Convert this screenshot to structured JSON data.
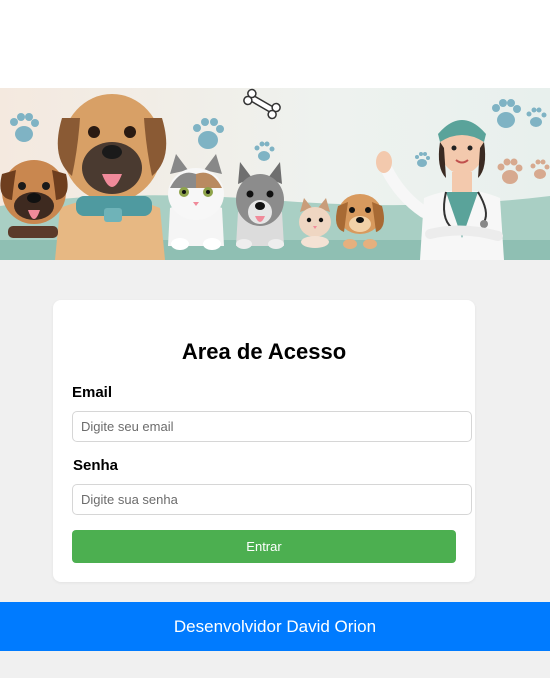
{
  "banner": {
    "image_alt": "",
    "icons": [
      "dog-icon",
      "cat-icon",
      "paw-icon",
      "bone-icon",
      "veterinarian-icon"
    ],
    "colors": {
      "teal": "#8fbfb3",
      "cream": "#f3ece4",
      "paw": "#7fb3c4"
    }
  },
  "login": {
    "title": "Area de Acesso",
    "email_label": "Email",
    "email_placeholder": "Digite seu email",
    "email_value": "",
    "password_label": "Senha",
    "password_placeholder": "Digite sua senha",
    "password_value": "",
    "submit_label": "Entrar"
  },
  "footer": {
    "text": "Desenvolvidor David Orion"
  },
  "colors": {
    "submit": "#4caf50",
    "footer": "#007bff",
    "background": "#f0f0f0"
  }
}
